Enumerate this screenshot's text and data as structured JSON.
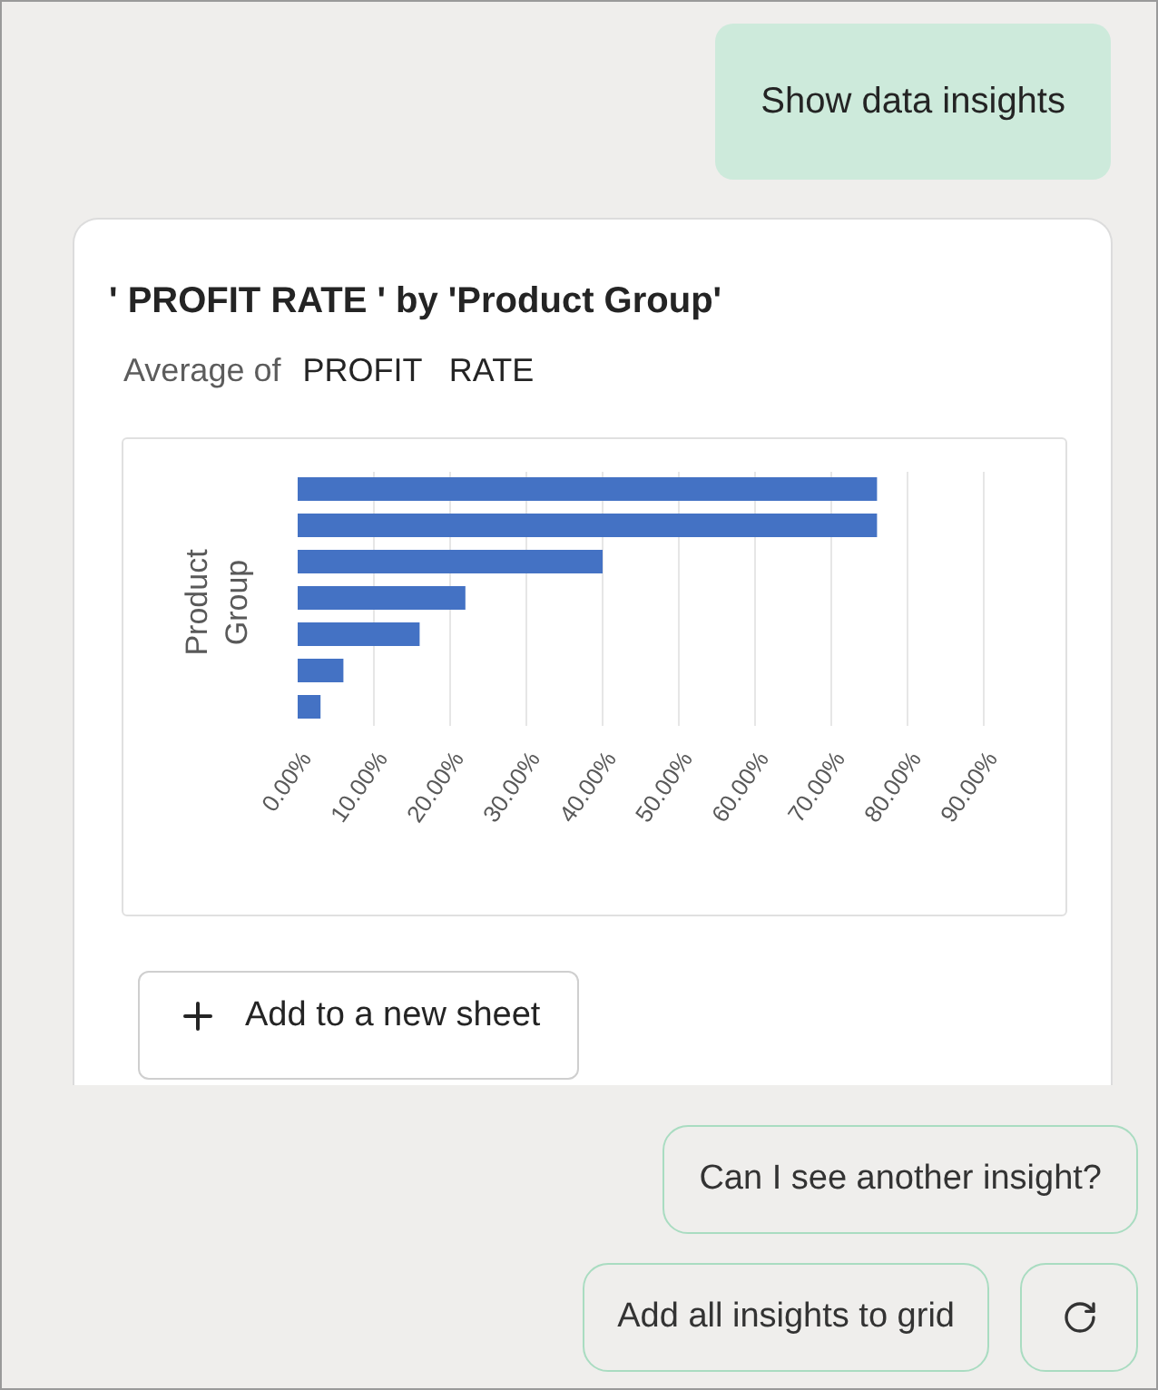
{
  "user_message": "Show data insights",
  "insight_card": {
    "title": "' PROFIT RATE ' by 'Product Group'",
    "subtitle_prefix": "Average of",
    "subtitle_field": "PROFIT   RATE",
    "chart_data": {
      "type": "bar",
      "orientation": "horizontal",
      "ylabel": "Product Group",
      "grid": true,
      "series": [
        {
          "color": "#4472c4",
          "values": [
            0.76,
            0.76,
            0.4,
            0.22,
            0.16,
            0.06,
            0.03
          ]
        }
      ],
      "xlim": [
        0,
        0.9
      ],
      "xticks": [
        {
          "value": 0,
          "label": "0.00%"
        },
        {
          "value": 0.1,
          "label": "10.00%"
        },
        {
          "value": 0.2,
          "label": "20.00%"
        },
        {
          "value": 0.3,
          "label": "30.00%"
        },
        {
          "value": 0.4,
          "label": "40.00%"
        },
        {
          "value": 0.5,
          "label": "50.00%"
        },
        {
          "value": 0.6,
          "label": "60.00%"
        },
        {
          "value": 0.7,
          "label": "70.00%"
        },
        {
          "value": 0.8,
          "label": "80.00%"
        },
        {
          "value": 0.9,
          "label": "90.00%"
        }
      ]
    },
    "add_button": "Add to a new sheet"
  },
  "suggestions": [
    "Can I see another insight?"
  ],
  "actions": [
    "Add all insights to grid"
  ]
}
